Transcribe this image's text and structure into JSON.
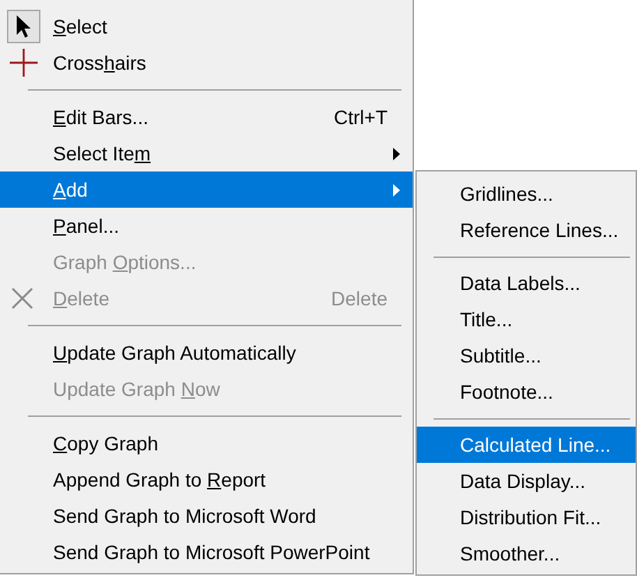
{
  "menu": {
    "items": [
      {
        "kind": "pointer",
        "label": {
          "key": "S",
          "after": "elect"
        },
        "checked": true,
        "selected": false,
        "disabled": false
      },
      {
        "kind": "crosshair",
        "label": {
          "before": "Cross",
          "key": "h",
          "after": "airs"
        },
        "checked": false,
        "selected": false,
        "disabled": false
      },
      {
        "kind": "separator"
      },
      {
        "kind": "item",
        "label": {
          "key": "E",
          "after": "dit Bars..."
        },
        "shortcut": "Ctrl+T",
        "submenu": false,
        "selected": false,
        "disabled": false
      },
      {
        "kind": "item",
        "label": {
          "before": "Select Ite",
          "key": "m"
        },
        "submenu": true,
        "selected": false,
        "disabled": false
      },
      {
        "kind": "item",
        "label": {
          "key": "A",
          "after": "dd"
        },
        "submenu": true,
        "selected": true,
        "disabled": false
      },
      {
        "kind": "item",
        "label": {
          "key": "P",
          "after": "anel..."
        },
        "submenu": false,
        "selected": false,
        "disabled": false
      },
      {
        "kind": "item",
        "label": {
          "before": "Graph ",
          "key": "O",
          "after": "ptions..."
        },
        "submenu": false,
        "selected": false,
        "disabled": true
      },
      {
        "kind": "delete",
        "label": {
          "key": "D",
          "after": "elete"
        },
        "shortcut": "Delete",
        "selected": false,
        "disabled": true
      },
      {
        "kind": "separator"
      },
      {
        "kind": "item",
        "label": {
          "key": "U",
          "after": "pdate Graph Automatically"
        },
        "submenu": false,
        "selected": false,
        "disabled": false
      },
      {
        "kind": "item",
        "label": {
          "before": "Update Graph ",
          "key": "N",
          "after": "ow"
        },
        "submenu": false,
        "selected": false,
        "disabled": true
      },
      {
        "kind": "separator"
      },
      {
        "kind": "item",
        "label": {
          "key": "C",
          "after": "opy Graph"
        },
        "submenu": false,
        "selected": false,
        "disabled": false
      },
      {
        "kind": "item",
        "label": {
          "before": "Append Graph to ",
          "key": "R",
          "after": "eport"
        },
        "submenu": false,
        "selected": false,
        "disabled": false
      },
      {
        "kind": "item",
        "label": {
          "before": "Send Graph to Microsoft Word"
        },
        "submenu": false,
        "selected": false,
        "disabled": false
      },
      {
        "kind": "item",
        "label": {
          "before": "Send Graph to Microsoft PowerPoint"
        },
        "submenu": false,
        "selected": false,
        "disabled": false
      }
    ]
  },
  "submenu": {
    "items": [
      {
        "kind": "item",
        "label": "Gridlines...",
        "selected": false
      },
      {
        "kind": "item",
        "label": "Reference Lines...",
        "selected": false
      },
      {
        "kind": "separator"
      },
      {
        "kind": "item",
        "label": "Data Labels...",
        "selected": false
      },
      {
        "kind": "item",
        "label": "Title...",
        "selected": false
      },
      {
        "kind": "item",
        "label": "Subtitle...",
        "selected": false
      },
      {
        "kind": "item",
        "label": "Footnote...",
        "selected": false
      },
      {
        "kind": "separator"
      },
      {
        "kind": "item",
        "label": "Calculated Line...",
        "selected": true
      },
      {
        "kind": "item",
        "label": "Data Display...",
        "selected": false
      },
      {
        "kind": "item",
        "label": "Distribution Fit...",
        "selected": false
      },
      {
        "kind": "item",
        "label": "Smoother...",
        "selected": false
      }
    ]
  }
}
